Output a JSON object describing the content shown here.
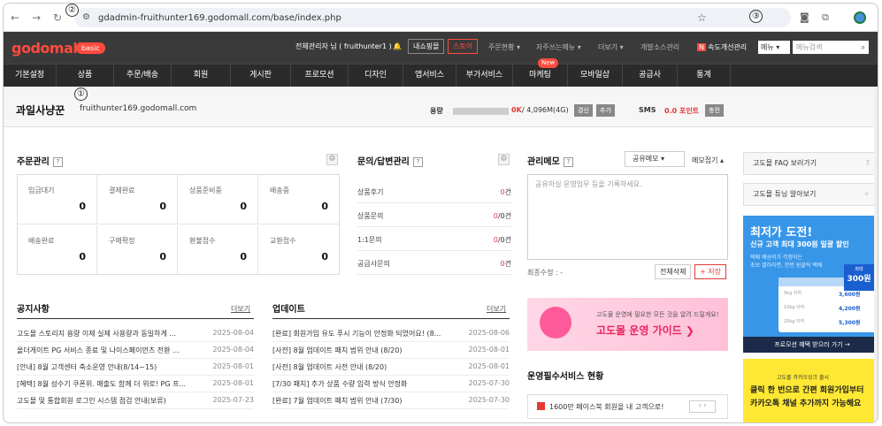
{
  "browser": {
    "url": "gdadmin-fruithunter169.godomall.com/base/index.php",
    "siteinfo": "⚙",
    "markers": [
      "①",
      "②",
      "③"
    ]
  },
  "topbar": {
    "logo": "godomall",
    "badge": "basic",
    "user": "전체관리자 님 ( fruithunter1 )",
    "btn_myinfo": "내쇼핑몰",
    "btn_store": "스토어",
    "links": [
      "주문현황 ▾",
      "자주쓰는메뉴 ▾",
      "더보기 ▾",
      "개발소스관리",
      "속도개선관리"
    ],
    "select_label": "메뉴 ▾",
    "search_placeholder": "메뉴검색"
  },
  "menu": {
    "items": [
      "기본설정",
      "상품",
      "주문/배송",
      "회원",
      "게시판",
      "프로모션",
      "디자인",
      "앱서비스",
      "부가서비스",
      "마케팅",
      "모바일샵",
      "공급사",
      "통계"
    ],
    "new_badge": "New"
  },
  "shop": {
    "name": "과일사냥꾼",
    "domain": "fruithunter169.godomall.com",
    "usage_label": "용량",
    "usage_value": "0K",
    "usage_total": " / 4,096M(4G)",
    "btn_apply": "결신",
    "btn_add": "추가",
    "sms_label": "SMS",
    "sms_value": "0.0 포인트",
    "btn_charge": "충전"
  },
  "orders": {
    "title": "주문관리",
    "cells": [
      {
        "label": "입금대기",
        "value": "0"
      },
      {
        "label": "결제완료",
        "value": "0"
      },
      {
        "label": "상품준비중",
        "value": "0"
      },
      {
        "label": "배송중",
        "value": "0"
      },
      {
        "label": "배송완료",
        "value": "0"
      },
      {
        "label": "구매확정",
        "value": "0"
      },
      {
        "label": "환불접수",
        "value": "0"
      },
      {
        "label": "교환접수",
        "value": "0"
      }
    ]
  },
  "qna": {
    "title": "문의/답변관리",
    "rows": [
      {
        "label": "상품후기",
        "red": "0",
        "rest": "건"
      },
      {
        "label": "상품문의",
        "red": "0",
        "rest": "/0건"
      },
      {
        "label": "1:1문의",
        "red": "0",
        "rest": "/0건"
      },
      {
        "label": "공급사문의",
        "red": "0",
        "rest": "건"
      }
    ]
  },
  "memo": {
    "title": "관리메모",
    "select": "공유메모 ▾",
    "fold": "메모접기 ▴",
    "placeholder": "공유하실 운영업무 등을 기록하세요.",
    "modified": "최종수정 : -",
    "delete_all": "전체삭제",
    "save": "+ 저장"
  },
  "notice": {
    "title": "공지사항",
    "more": "더보기",
    "items": [
      {
        "t": "고도몰 스토리지 용량 이제 실제 사용량과 동일하게 ...",
        "d": "2025-08-04"
      },
      {
        "t": "올더게이트 PG 서비스 종료 및 나이스페이먼츠 전환 ...",
        "d": "2025-08-04"
      },
      {
        "t": "[안내] 8월 고객센터 축소운영 안내(8/14~15)",
        "d": "2025-08-01"
      },
      {
        "t": "[혜택] 8월 성수기 쿠폰위. 매출도 함께 더 위로! PG 프...",
        "d": "2025-08-01"
      },
      {
        "t": "고도몰 및 통합회원 로그인 시스템 점검 안내(보류)",
        "d": "2025-07-23"
      }
    ]
  },
  "updates": {
    "title": "업데이트",
    "more": "더보기",
    "items": [
      {
        "t": "[완료] 회원가입 유도 푸시 기능이 안정화 되었어요! (8...",
        "d": "2025-08-06"
      },
      {
        "t": "[사전] 8월 업데이트 패치 범위 안내 (8/20)",
        "d": "2025-08-01"
      },
      {
        "t": "[사전] 8월 업데이트 사전 안내 (8/20)",
        "d": "2025-08-01"
      },
      {
        "t": "[7/30 패치] 추가 상품 수량 입력 방식 안정화",
        "d": "2025-07-30"
      },
      {
        "t": "[완료] 7월 업데이트 패치 범위 안내 (7/30)",
        "d": "2025-07-30"
      }
    ]
  },
  "guide": {
    "sub": "고도몰 운영에 필요한 모든 것을 알려 드릴게요!",
    "title": "고도몰 운영 가이드 ❯"
  },
  "service": {
    "title": "운영필수서비스 현황",
    "item": "1600만 페이스북 회원을 내 고객으로!"
  },
  "right": {
    "faq": "고도몰 FAQ 보러가기",
    "tuning": "고도몰 튜닝 알아보기",
    "b1_title": "최저가 도전!",
    "b1_sub": "신규 고객 최대 300원 일괄 할인",
    "b1_desc1": "택배 배송비가 걱정되는",
    "b1_desc2": "초보 셀러라면, 한번 원클릭 택배",
    "b1_max": "최대",
    "b1_amount": "300원",
    "b1_rows": [
      [
        "5kg 이하",
        "3,600원"
      ],
      [
        "10kg 이하",
        "4,200원"
      ],
      [
        "20kg 이하",
        "5,300원"
      ]
    ],
    "b1_footer": "프로모션 혜택 받으러 가기 →",
    "b2_small": "고도몰 카카오싱크 출시",
    "b2_line1": "클릭 한 번으로 간편 회원가입부터",
    "b2_line2": "카카오톡 채널 추가까지 가능해요"
  }
}
